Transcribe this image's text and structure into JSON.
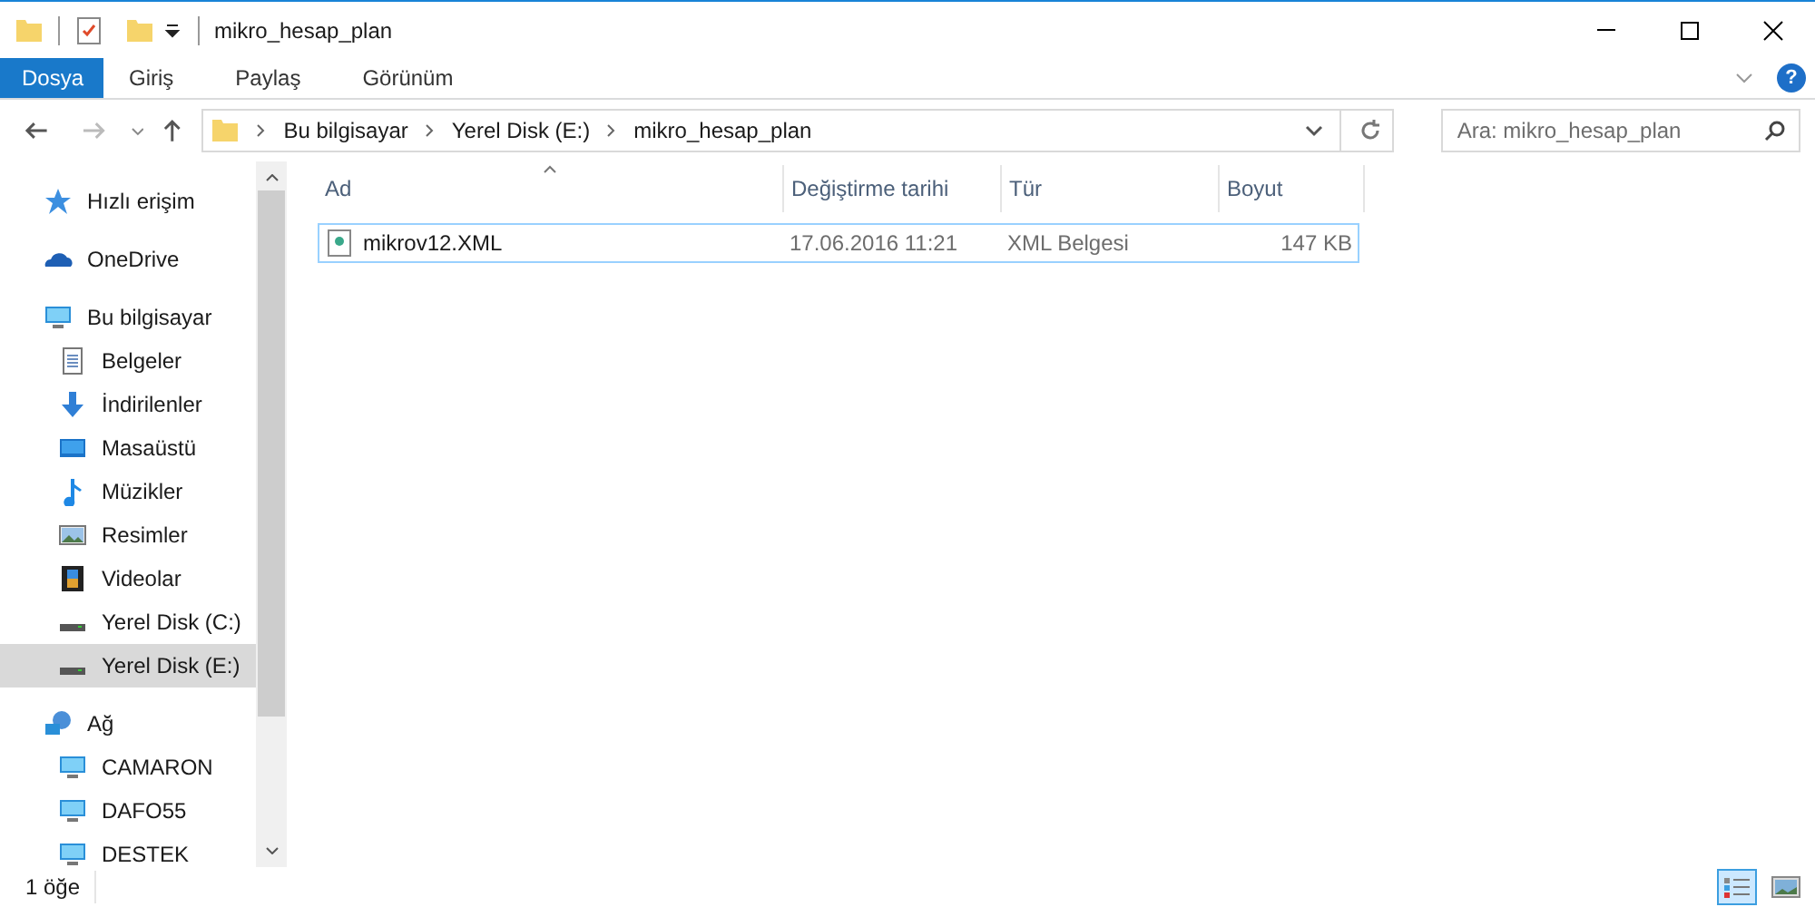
{
  "window": {
    "title": "mikro_hesap_plan"
  },
  "ribbon_tabs": [
    {
      "label": "Dosya",
      "kind": "file"
    },
    {
      "label": "Giriş",
      "kind": "tab"
    },
    {
      "label": "Paylaş",
      "kind": "tab"
    },
    {
      "label": "Görünüm",
      "kind": "tab"
    }
  ],
  "help": "?",
  "address": {
    "crumbs": [
      "Bu bilgisayar",
      "Yerel Disk (E:)",
      "mikro_hesap_plan"
    ]
  },
  "search": {
    "placeholder": "Ara: mikro_hesap_plan"
  },
  "nav": [
    {
      "label": "Hızlı erişim",
      "kind": "star",
      "selected": false
    },
    {
      "label": "OneDrive",
      "kind": "cloud",
      "selected": false
    },
    {
      "label": "Bu bilgisayar",
      "kind": "pc",
      "selected": false,
      "children": [
        {
          "label": "Belgeler",
          "kind": "doc",
          "selected": false
        },
        {
          "label": "İndirilenler",
          "kind": "download",
          "selected": false
        },
        {
          "label": "Masaüstü",
          "kind": "desktop",
          "selected": false
        },
        {
          "label": "Müzikler",
          "kind": "music",
          "selected": false
        },
        {
          "label": "Resimler",
          "kind": "image",
          "selected": false
        },
        {
          "label": "Videolar",
          "kind": "video",
          "selected": false
        },
        {
          "label": "Yerel Disk (C:)",
          "kind": "drive",
          "selected": false
        },
        {
          "label": "Yerel Disk (E:)",
          "kind": "drive",
          "selected": true
        }
      ]
    },
    {
      "label": "Ağ",
      "kind": "network",
      "selected": false,
      "children": [
        {
          "label": "CAMARON",
          "kind": "pc",
          "selected": false
        },
        {
          "label": "DAFO55",
          "kind": "pc",
          "selected": false
        },
        {
          "label": "DESTEK",
          "kind": "pc",
          "selected": false
        }
      ]
    }
  ],
  "table": {
    "columns": [
      "Ad",
      "Değiştirme tarihi",
      "Tür",
      "Boyut"
    ],
    "rows": [
      {
        "cells": [
          "mikrov12.XML",
          "17.06.2016 11:21",
          "XML Belgesi",
          "147 KB"
        ],
        "focused": true
      }
    ]
  },
  "status_bar": {
    "count": "1 öğe",
    "view_buttons": [
      {
        "kind": "details",
        "selected": true
      },
      {
        "kind": "thumbnails",
        "selected": false
      }
    ]
  }
}
